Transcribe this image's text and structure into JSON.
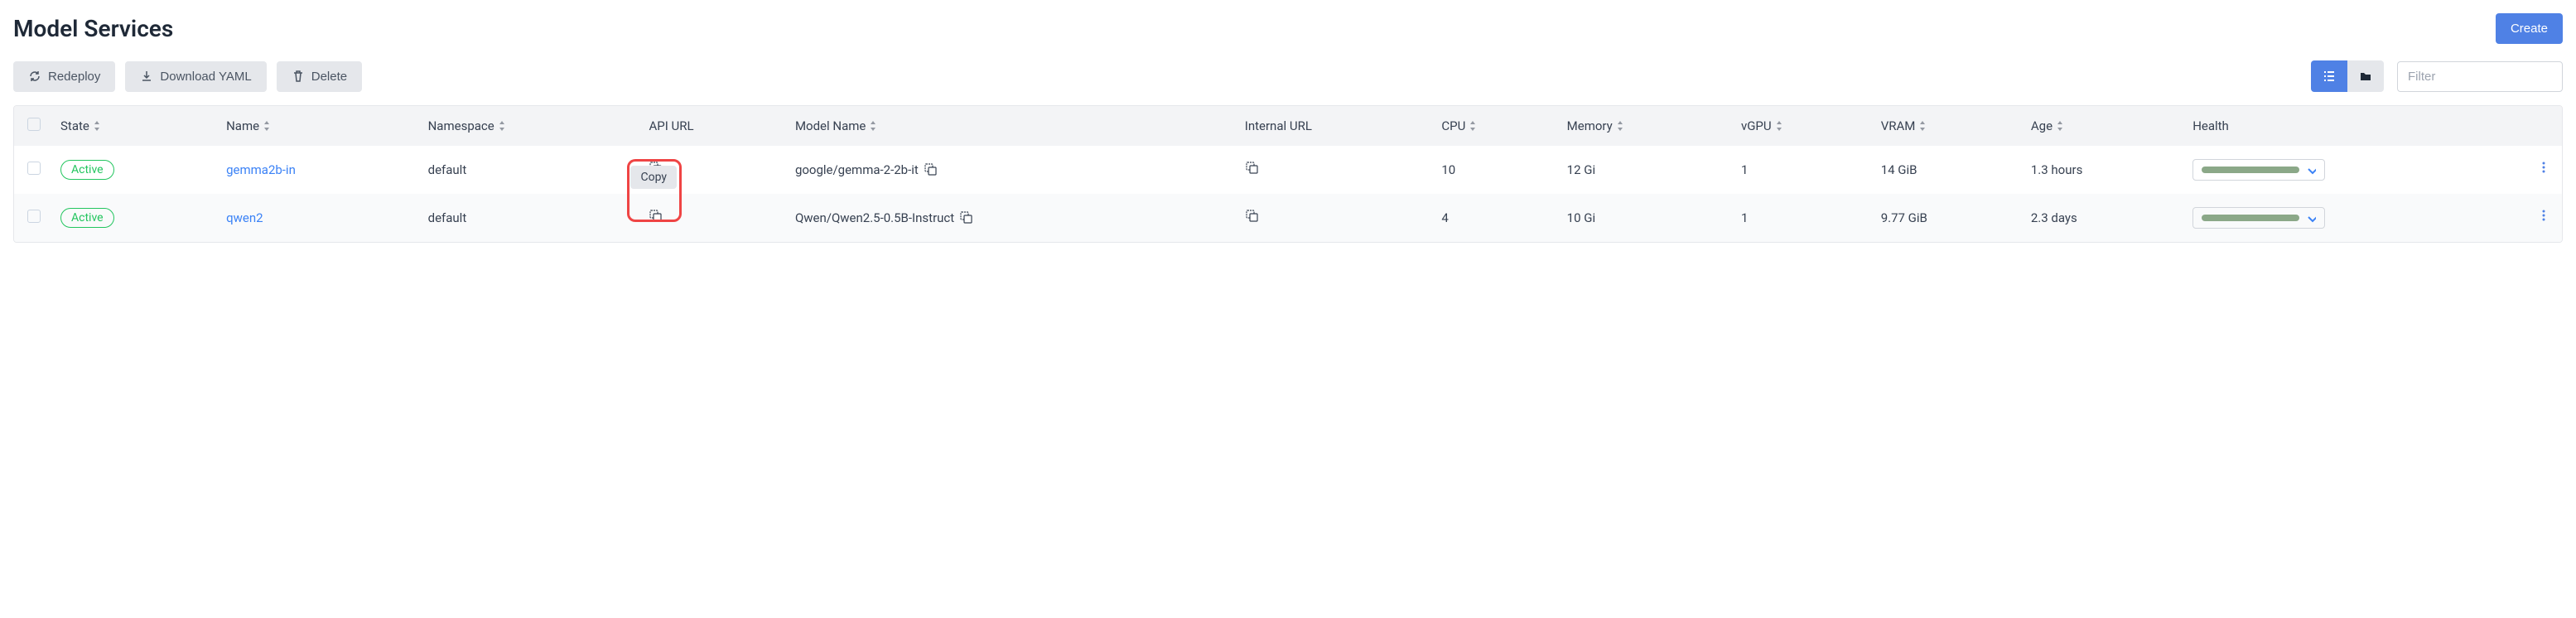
{
  "page": {
    "title": "Model Services"
  },
  "buttons": {
    "create": "Create",
    "redeploy": "Redeploy",
    "download_yaml": "Download YAML",
    "delete": "Delete"
  },
  "filter": {
    "placeholder": "Filter"
  },
  "tooltip": {
    "copy": "Copy"
  },
  "columns": {
    "state": "State",
    "name": "Name",
    "namespace": "Namespace",
    "api_url": "API URL",
    "model_name": "Model Name",
    "internal_url": "Internal URL",
    "cpu": "CPU",
    "memory": "Memory",
    "vgpu": "vGPU",
    "vram": "VRAM",
    "age": "Age",
    "health": "Health"
  },
  "rows": [
    {
      "state": "Active",
      "name": "gemma2b-in",
      "namespace": "default",
      "model_name": "google/gemma-2-2b-it",
      "cpu": "10",
      "memory": "12 Gi",
      "vgpu": "1",
      "vram": "14 GiB",
      "age": "1.3 hours"
    },
    {
      "state": "Active",
      "name": "qwen2",
      "namespace": "default",
      "model_name": "Qwen/Qwen2.5-0.5B-Instruct",
      "cpu": "4",
      "memory": "10 Gi",
      "vgpu": "1",
      "vram": "9.77 GiB",
      "age": "2.3 days"
    }
  ],
  "colors": {
    "primary": "#4f81e5",
    "active_badge": "#22c55e",
    "highlight": "#ef4444",
    "health_fill": "#8ba888"
  }
}
